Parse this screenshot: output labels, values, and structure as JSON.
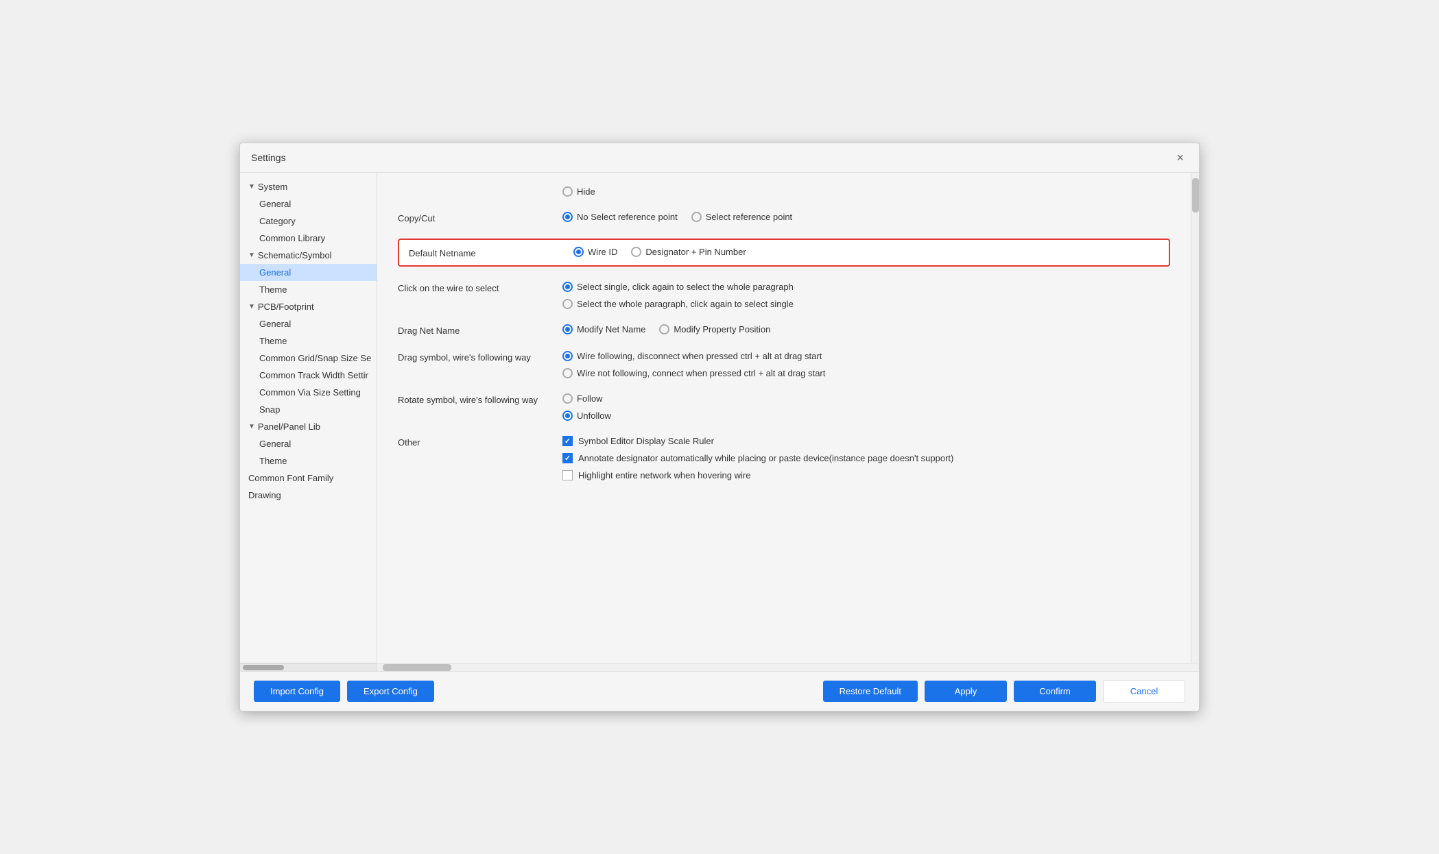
{
  "dialog": {
    "title": "Settings",
    "close_label": "×"
  },
  "sidebar": {
    "items": [
      {
        "id": "system",
        "label": "System",
        "type": "group",
        "level": 0,
        "chevron": "▼"
      },
      {
        "id": "general-sys",
        "label": "General",
        "type": "child",
        "level": 1
      },
      {
        "id": "category",
        "label": "Category",
        "type": "child",
        "level": 1
      },
      {
        "id": "common-library",
        "label": "Common Library",
        "type": "child",
        "level": 1
      },
      {
        "id": "schematic-symbol",
        "label": "Schematic/Symbol",
        "type": "group",
        "level": 0,
        "chevron": "▼"
      },
      {
        "id": "general-sch",
        "label": "General",
        "type": "child",
        "level": 1,
        "active": true
      },
      {
        "id": "theme-sch",
        "label": "Theme",
        "type": "child",
        "level": 1
      },
      {
        "id": "pcb-footprint",
        "label": "PCB/Footprint",
        "type": "group",
        "level": 0,
        "chevron": "▼"
      },
      {
        "id": "general-pcb",
        "label": "General",
        "type": "child",
        "level": 1
      },
      {
        "id": "theme-pcb",
        "label": "Theme",
        "type": "child",
        "level": 1
      },
      {
        "id": "common-grid",
        "label": "Common Grid/Snap Size Se",
        "type": "child",
        "level": 1
      },
      {
        "id": "common-track",
        "label": "Common Track Width Settir",
        "type": "child",
        "level": 1
      },
      {
        "id": "common-via",
        "label": "Common Via Size Setting",
        "type": "child",
        "level": 1
      },
      {
        "id": "snap",
        "label": "Snap",
        "type": "child",
        "level": 1
      },
      {
        "id": "panel-lib",
        "label": "Panel/Panel Lib",
        "type": "group",
        "level": 0,
        "chevron": "▼"
      },
      {
        "id": "general-panel",
        "label": "General",
        "type": "child",
        "level": 1
      },
      {
        "id": "theme-panel",
        "label": "Theme",
        "type": "child",
        "level": 1
      },
      {
        "id": "common-font",
        "label": "Common Font Family",
        "type": "child",
        "level": 0
      },
      {
        "id": "drawing",
        "label": "Drawing",
        "type": "child",
        "level": 0
      }
    ]
  },
  "main": {
    "rows": [
      {
        "id": "hide-row",
        "label": "",
        "type": "radio-row",
        "options": [
          {
            "id": "hide",
            "label": "Hide",
            "selected": false
          }
        ]
      },
      {
        "id": "copy-cut",
        "label": "Copy/Cut",
        "type": "radio-row",
        "options": [
          {
            "id": "no-select-ref",
            "label": "No Select reference point",
            "selected": true
          },
          {
            "id": "select-ref",
            "label": "Select reference point",
            "selected": false
          }
        ]
      },
      {
        "id": "default-netname",
        "label": "Default Netname",
        "highlighted": true,
        "type": "radio-row",
        "options": [
          {
            "id": "wire-id",
            "label": "Wire ID",
            "selected": true
          },
          {
            "id": "designator-pin",
            "label": "Designator + Pin Number",
            "selected": false
          }
        ]
      },
      {
        "id": "click-wire",
        "label": "Click on the wire to select",
        "type": "radio-col",
        "options": [
          {
            "id": "select-single",
            "label": "Select single, click again to select the whole paragraph",
            "selected": true
          },
          {
            "id": "select-whole",
            "label": "Select the whole paragraph, click again to select single",
            "selected": false
          }
        ]
      },
      {
        "id": "drag-net",
        "label": "Drag Net Name",
        "type": "radio-row",
        "options": [
          {
            "id": "modify-net",
            "label": "Modify Net Name",
            "selected": true
          },
          {
            "id": "modify-prop",
            "label": "Modify Property Position",
            "selected": false
          }
        ]
      },
      {
        "id": "drag-symbol",
        "label": "Drag symbol, wire's following way",
        "type": "radio-col",
        "options": [
          {
            "id": "wire-following",
            "label": "Wire following, disconnect when pressed ctrl + alt at drag start",
            "selected": true
          },
          {
            "id": "wire-not-following",
            "label": "Wire not following, connect when pressed ctrl + alt at drag start",
            "selected": false
          }
        ]
      },
      {
        "id": "rotate-symbol",
        "label": "Rotate symbol, wire's following way",
        "type": "radio-col",
        "options": [
          {
            "id": "follow",
            "label": "Follow",
            "selected": false
          },
          {
            "id": "unfollow",
            "label": "Unfollow",
            "selected": true
          }
        ]
      },
      {
        "id": "other",
        "label": "Other",
        "type": "checkbox-col",
        "options": [
          {
            "id": "symbol-editor",
            "label": "Symbol Editor Display Scale Ruler",
            "checked": true
          },
          {
            "id": "annotate-designator",
            "label": "Annotate designator automatically while placing or paste device(instance page doesn't support)",
            "checked": true
          },
          {
            "id": "highlight-network",
            "label": "Highlight entire network when hovering wire",
            "checked": false
          }
        ]
      }
    ]
  },
  "footer": {
    "import_label": "Import Config",
    "export_label": "Export Config",
    "restore_label": "Restore Default",
    "apply_label": "Apply",
    "confirm_label": "Confirm",
    "cancel_label": "Cancel"
  },
  "colors": {
    "blue": "#1a73e8",
    "red_border": "#e53935",
    "active_bg": "#cce0ff",
    "active_text": "#1a73e8"
  }
}
